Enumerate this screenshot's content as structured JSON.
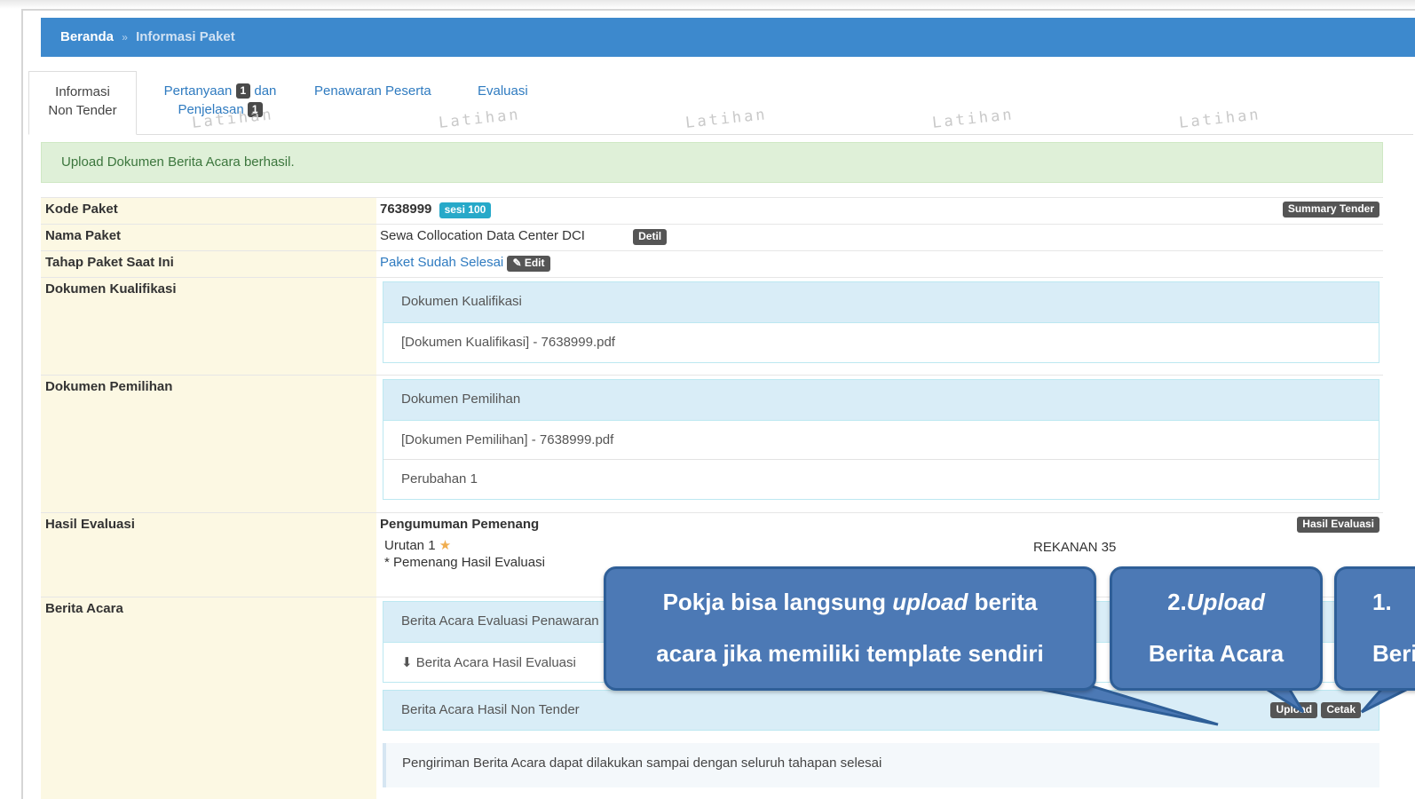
{
  "breadcrumb": {
    "home": "Beranda",
    "separator": "»",
    "current": "Informasi Paket"
  },
  "tabs": [
    {
      "label_line1": "Informasi",
      "label_line2": "Non Tender"
    },
    {
      "label_a": "Pertanyaan",
      "badge_a": "1",
      "label_b": "dan",
      "label_c": "Penjelasan",
      "badge_c": "1"
    },
    {
      "label": "Penawaran Peserta"
    },
    {
      "label": "Evaluasi"
    }
  ],
  "watermark": "Latihan",
  "alert": "Upload Dokumen Berita Acara berhasil.",
  "rows": {
    "kode_paket": {
      "label": "Kode Paket",
      "value": "7638999",
      "badge": "sesi 100",
      "action": "Summary Tender"
    },
    "nama_paket": {
      "label": "Nama Paket",
      "value": "Sewa Collocation Data Center DCI",
      "action": "Detil"
    },
    "tahap": {
      "label": "Tahap Paket Saat Ini",
      "value": "Paket Sudah Selesai",
      "action": "Edit"
    },
    "dok_kualifikasi": {
      "label": "Dokumen Kualifikasi",
      "panel_title": "Dokumen Kualifikasi",
      "items": [
        "[Dokumen Kualifikasi] - 7638999.pdf"
      ]
    },
    "dok_pemilihan": {
      "label": "Dokumen Pemilihan",
      "panel_title": "Dokumen Pemilihan",
      "items": [
        "[Dokumen Pemilihan] - 7638999.pdf",
        "Perubahan 1"
      ]
    },
    "hasil_evaluasi": {
      "label": "Hasil Evaluasi",
      "title": "Pengumuman Pemenang",
      "action": "Hasil Evaluasi",
      "rank": "Urutan 1",
      "note": "* Pemenang Hasil Evaluasi",
      "winner": "REKANAN 35"
    },
    "berita_acara": {
      "label": "Berita Acara",
      "panel1_title": "Berita Acara Evaluasi Penawaran",
      "panel1_item": "Berita Acara Hasil Evaluasi",
      "panel2_title": "Berita Acara Hasil Non Tender",
      "upload_label": "Upload",
      "cetak_label": "Cetak",
      "note": "Pengiriman Berita Acara dapat dilakukan sampai dengan seluruh tahapan selesai"
    }
  },
  "callouts": {
    "c1_line1_pre": "Pokja bisa langsung ",
    "c1_line1_em": "upload",
    "c1_line1_post": " berita",
    "c1_line2": "acara jika memiliki template sendiri",
    "c2_line1_pre": "2.",
    "c2_line1_em": "Upload",
    "c2_line2": "Berita Acara",
    "c3_line1": "1.",
    "c3_line2": "Beri"
  },
  "colors": {
    "navbar": "#3d89cd",
    "callout": "#4c79b5",
    "alert_bg": "#dff0d8",
    "label_bg": "#fcf8e3",
    "panel_head": "#d9edf7"
  }
}
